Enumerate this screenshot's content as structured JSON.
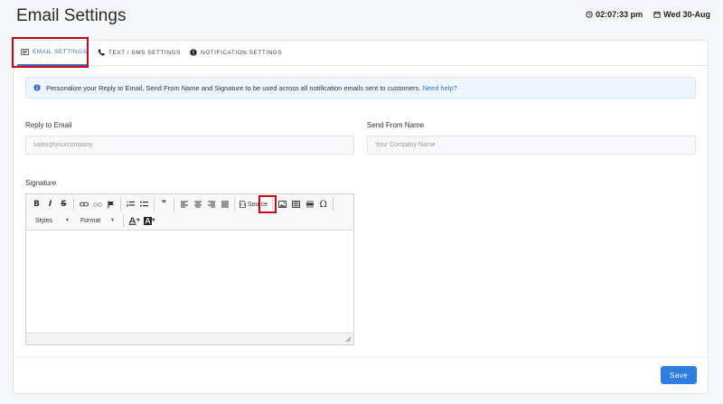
{
  "header": {
    "title": "Email Settings",
    "time": "02:07:33 pm",
    "date": "Wed 30-Aug"
  },
  "tabs": [
    {
      "label": "EMAIL SETTINGS",
      "icon": "envelope-icon",
      "active": true
    },
    {
      "label": "TEXT / SMS SETTINGS",
      "icon": "phone-icon",
      "active": false
    },
    {
      "label": "NOTIFICATION SETTINGS",
      "icon": "exclamation-circle-icon",
      "active": false
    }
  ],
  "info": {
    "text": "Personalize your Reply to Email, Send From Name and Signature to be used across all notification emails sent to customers.",
    "link": "Need help?"
  },
  "form": {
    "reply_label": "Reply to Email",
    "reply_placeholder": "sales@yourcompany",
    "from_label": "Send From Name",
    "from_placeholder": "Your Company Name",
    "signature_label": "Signature"
  },
  "editor": {
    "source_label": "Source",
    "styles_label": "Styles",
    "format_label": "Format",
    "bold": "B",
    "italic": "I",
    "strike": "S",
    "quote": "❞",
    "omega": "Ω"
  },
  "footer": {
    "save_label": "Save"
  },
  "colors": {
    "accent": "#3b6fc6",
    "save_button": "#2f7de1",
    "highlight": "#d0021b"
  }
}
